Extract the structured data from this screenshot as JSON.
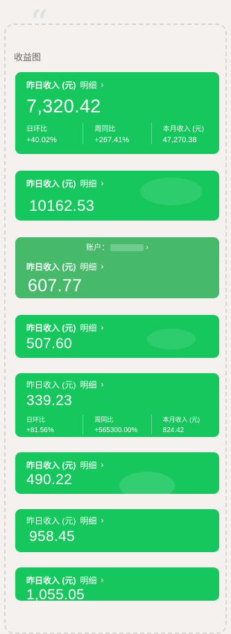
{
  "section_title": "收益图",
  "detail_label": "明细",
  "cards": [
    {
      "label": "昨日收入 (元)",
      "value": "7,320.42",
      "stats": [
        {
          "label": "日环比",
          "value": "+40.02%"
        },
        {
          "label": "周同比",
          "value": "+267.41%"
        },
        {
          "label": "本月收入 (元)",
          "value": "47,270.38"
        }
      ]
    },
    {
      "label": "昨日收入 (元)",
      "value": "10162.53"
    },
    {
      "account_label": "账户：",
      "label": "昨日收入 (元)",
      "value": "607.77"
    },
    {
      "label": "昨日收入 (元)",
      "value": "507.60"
    },
    {
      "label": "昨日收入 (元)",
      "value": "339.23",
      "stats": [
        {
          "label": "日环比",
          "value": "+81.56%"
        },
        {
          "label": "周同比",
          "value": "+565300.00%"
        },
        {
          "label": "本月收入 (元)",
          "value": "824.42"
        }
      ]
    },
    {
      "label": "昨日收入 (元)",
      "value": "490.22"
    },
    {
      "label": "昨日收入 (元)",
      "value": "958.45"
    },
    {
      "label": "昨日收入 (元)",
      "value": "1,055.05"
    }
  ],
  "colors": {
    "card_green": "#16c75d",
    "card_green_muted": "#47b96b",
    "page_bg": "#f4f1ee"
  },
  "icons": [
    "quote-icon",
    "chevron-right-icon"
  ]
}
